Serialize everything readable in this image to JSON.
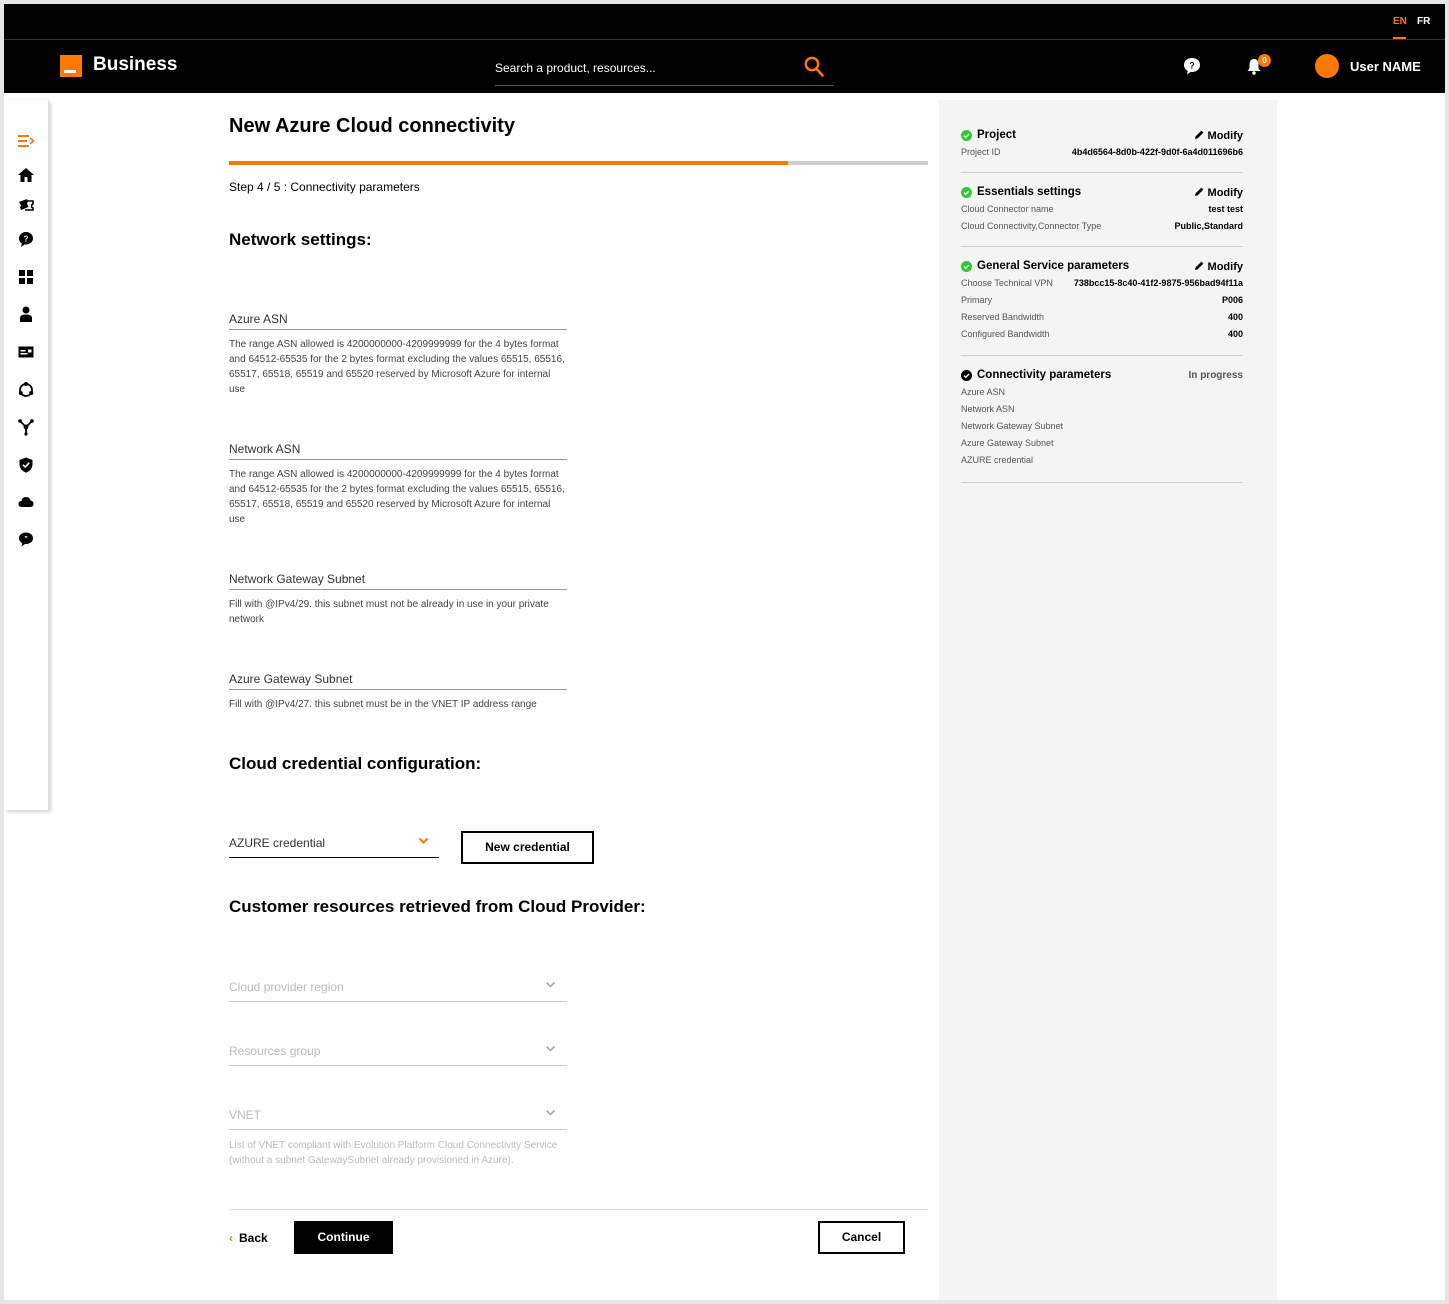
{
  "lang": {
    "en": "EN",
    "fr": "FR"
  },
  "header": {
    "brand": "Business",
    "search_placeholder": "Search a product, resources...",
    "notification_count": "0",
    "user_name": "User NAME"
  },
  "sidebar": {
    "icons": [
      "menu-icon",
      "home-icon",
      "tickets-icon",
      "help-icon",
      "dashboard-icon",
      "user-icon",
      "billing-icon",
      "network-icon",
      "topology-icon",
      "security-icon",
      "cloud-icon",
      "chat-icon"
    ]
  },
  "main": {
    "title": "New Azure Cloud connectivity",
    "progress": 0.8,
    "step": "Step 4 / 5 : Connectivity parameters",
    "network_settings_title": "Network settings:",
    "fields": {
      "azure_asn": {
        "label": "Azure ASN",
        "help": "The range ASN allowed is 4200000000-4209999999 for the 4 bytes format and 64512-65535 for the 2 bytes format excluding the values 65515, 65516, 65517, 65518, 65519 and 65520 reserved by Microsoft Azure for internal use"
      },
      "network_asn": {
        "label": "Network ASN",
        "help": "The range ASN allowed is 4200000000-4209999999 for the 4 bytes format and 64512-65535 for the 2 bytes format excluding the values 65515, 65516, 65517, 65518, 65519 and 65520 reserved by Microsoft Azure for internal use"
      },
      "network_gateway_subnet": {
        "label": "Network Gateway Subnet",
        "help": "Fill with @IPv4/29. this subnet must not be already in use in your private network"
      },
      "azure_gateway_subnet": {
        "label": "Azure Gateway Subnet",
        "help": "Fill with @IPv4/27. this subnet must be in the VNET IP address range"
      }
    },
    "credential_title": "Cloud credential configuration:",
    "credential_select": "AZURE credential",
    "new_credential": "New credential",
    "resources_title": "Customer resources retrieved from Cloud Provider:",
    "region_select": "Cloud provider region",
    "resources_group_select": "Resources group",
    "vnet_select": "VNET",
    "vnet_help": "List of VNET compliant with Evolution Platform Cloud Connectivity Service (without a subnet GatewaySubnet already provisioned in Azure).",
    "back": "Back",
    "continue": "Continue",
    "cancel": "Cancel"
  },
  "summary": {
    "modify_label": "Modify",
    "check_color": "#32c832",
    "project": {
      "title": "Project",
      "rows": [
        {
          "k": "Project ID",
          "v": "4b4d6564-8d0b-422f-9d0f-6a4d011696b6"
        }
      ]
    },
    "essentials": {
      "title": "Essentials settings",
      "rows": [
        {
          "k": "Cloud Connector name",
          "v": "test test"
        },
        {
          "k": "Cloud Connectivity,Connector Type",
          "v": "Public,Standard"
        }
      ]
    },
    "general": {
      "title": "General Service parameters",
      "rows": [
        {
          "k": "Choose Technical VPN",
          "v": "738bcc15-8c40-41f2-9875-956bad94f11a"
        },
        {
          "k": "Primary",
          "v": "P006"
        },
        {
          "k": "Reserved Bandwidth",
          "v": "400"
        },
        {
          "k": "Configured Bandwidth",
          "v": "400"
        }
      ]
    },
    "connectivity": {
      "title": "Connectivity parameters",
      "status": "In progress",
      "rows": [
        {
          "k": "Azure ASN",
          "v": ""
        },
        {
          "k": "Network ASN",
          "v": ""
        },
        {
          "k": "Network Gateway Subnet",
          "v": ""
        },
        {
          "k": "Azure Gateway Subnet",
          "v": ""
        },
        {
          "k": "AZURE credential",
          "v": ""
        }
      ]
    }
  }
}
